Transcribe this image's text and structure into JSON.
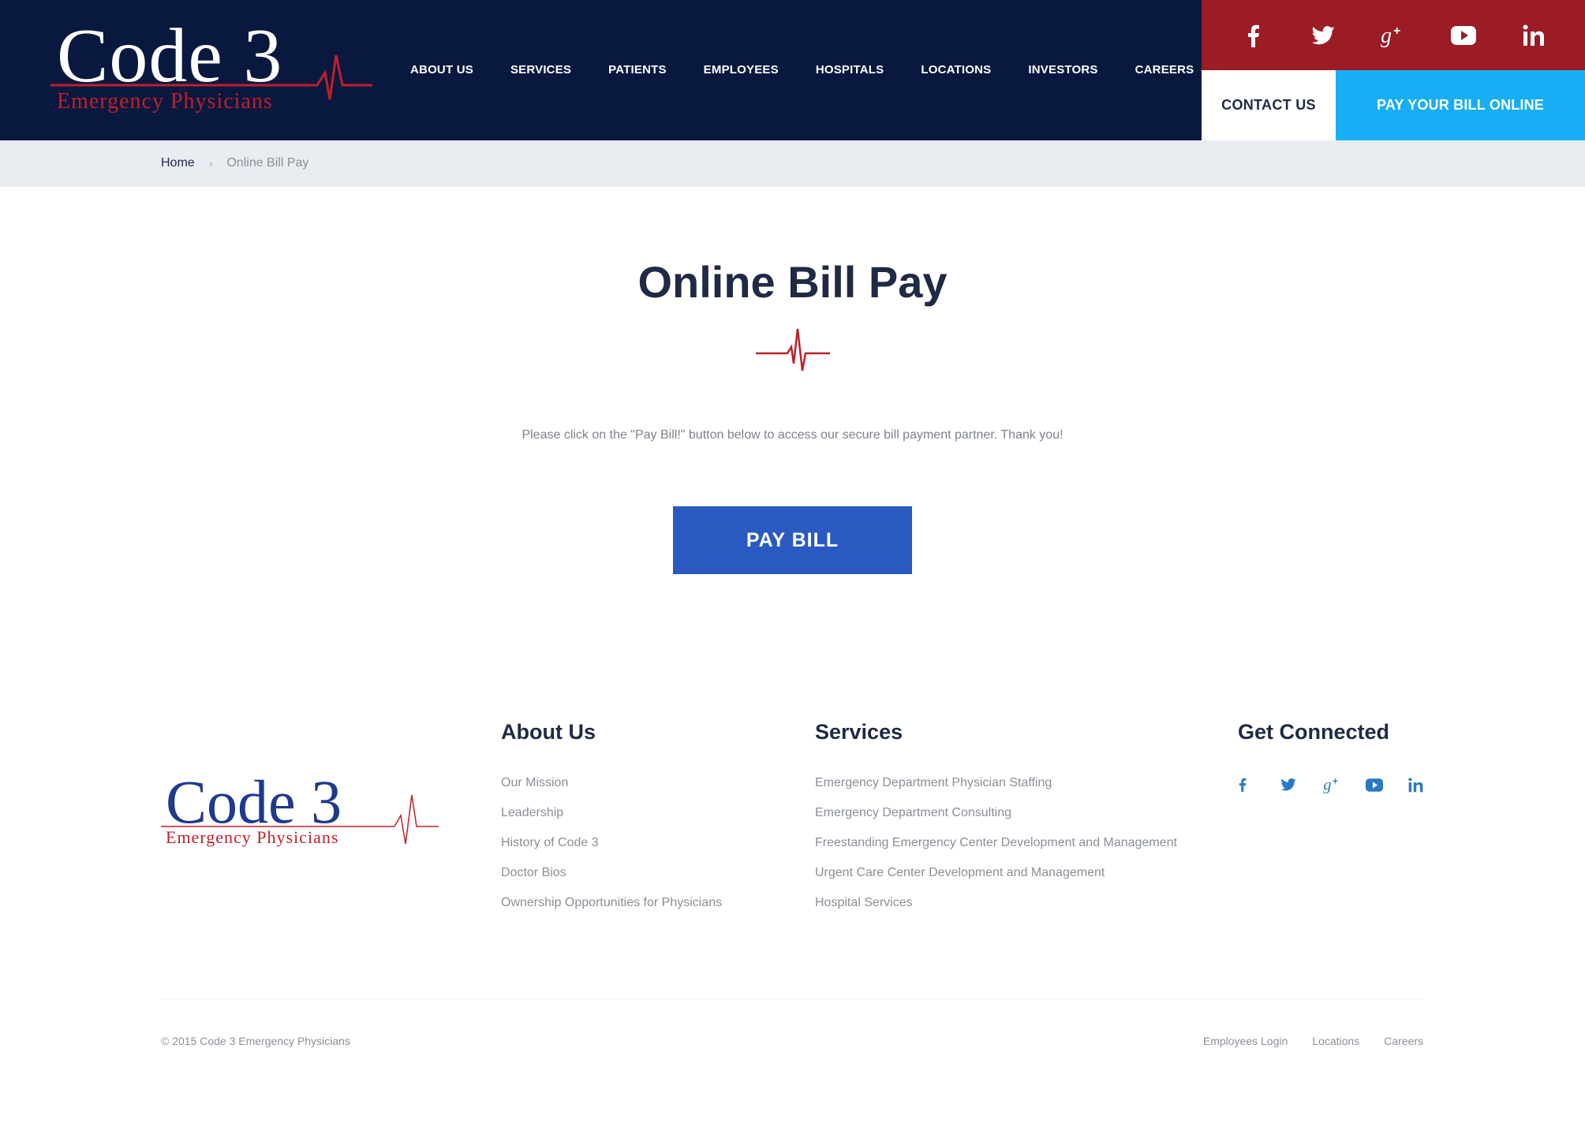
{
  "brand": {
    "name": "Code 3",
    "subtitle": "Emergency Physicians"
  },
  "nav": {
    "items": [
      "ABOUT US",
      "SERVICES",
      "PATIENTS",
      "EMPLOYEES",
      "HOSPITALS",
      "LOCATIONS",
      "INVESTORS",
      "CAREERS"
    ]
  },
  "header_actions": {
    "contact": "CONTACT US",
    "pay_online": "PAY YOUR BILL ONLINE"
  },
  "social_icons": [
    "facebook-icon",
    "twitter-icon",
    "google-plus-icon",
    "youtube-icon",
    "linkedin-icon"
  ],
  "breadcrumb": {
    "home": "Home",
    "separator": "›",
    "current": "Online Bill Pay"
  },
  "main": {
    "title": "Online Bill Pay",
    "intro": "Please click on the \"Pay Bill!\" button below to access our secure bill payment partner. Thank you!",
    "pay_button": "PAY BILL"
  },
  "footer": {
    "about": {
      "heading": "About Us",
      "links": [
        "Our Mission",
        "Leadership",
        "History of Code 3",
        "Doctor Bios",
        "Ownership Opportunities for Physicians"
      ]
    },
    "services": {
      "heading": "Services",
      "links": [
        "Emergency Department Physician Staffing",
        "Emergency Department Consulting",
        "Freestanding Emergency Center Development and Management",
        "Urgent Care Center Development and Management",
        "Hospital Services"
      ]
    },
    "connect": {
      "heading": "Get Connected"
    },
    "copyright": "© 2015 Code 3 Emergency Physicians",
    "bottom_links": [
      "Employees Login",
      "Locations",
      "Careers"
    ]
  },
  "colors": {
    "header_bg": "#09183f",
    "social_bg": "#9b1c25",
    "pay_online_bg": "#17aef5",
    "pay_button_bg": "#2a59c2",
    "accent_red": "#c0202a",
    "footer_icon": "#2a79c2"
  }
}
